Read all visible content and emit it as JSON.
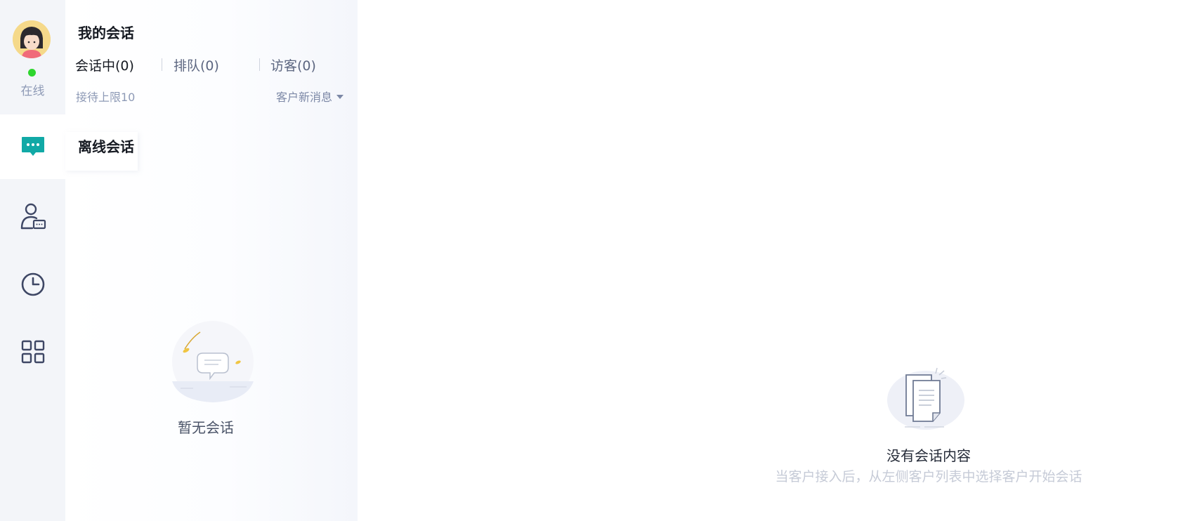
{
  "rail": {
    "status_label": "在线",
    "status_color": "#2ed62e",
    "items": [
      {
        "icon": "chat-bubble-icon",
        "active": true
      },
      {
        "icon": "customer-contact-icon",
        "active": false
      },
      {
        "icon": "clock-history-icon",
        "active": false
      },
      {
        "icon": "apps-grid-icon",
        "active": false
      }
    ]
  },
  "panel": {
    "title": "我的会话",
    "tabs": [
      {
        "label": "会话中(0)",
        "active": true
      },
      {
        "label": "排队(0)",
        "active": false
      },
      {
        "label": "访客(0)",
        "active": false
      }
    ],
    "limit_label": "接待上限10",
    "sort_label": "客户新消息",
    "offline_label": "离线会话",
    "empty_text": "暂无会话"
  },
  "main": {
    "empty_title": "没有会话内容",
    "empty_subtitle": "当客户接入后，从左侧客户列表中选择客户开始会话"
  },
  "colors": {
    "accent": "#11a9a6",
    "rail_bg": "#f3f5f9",
    "icon_dark": "#3e4765"
  }
}
